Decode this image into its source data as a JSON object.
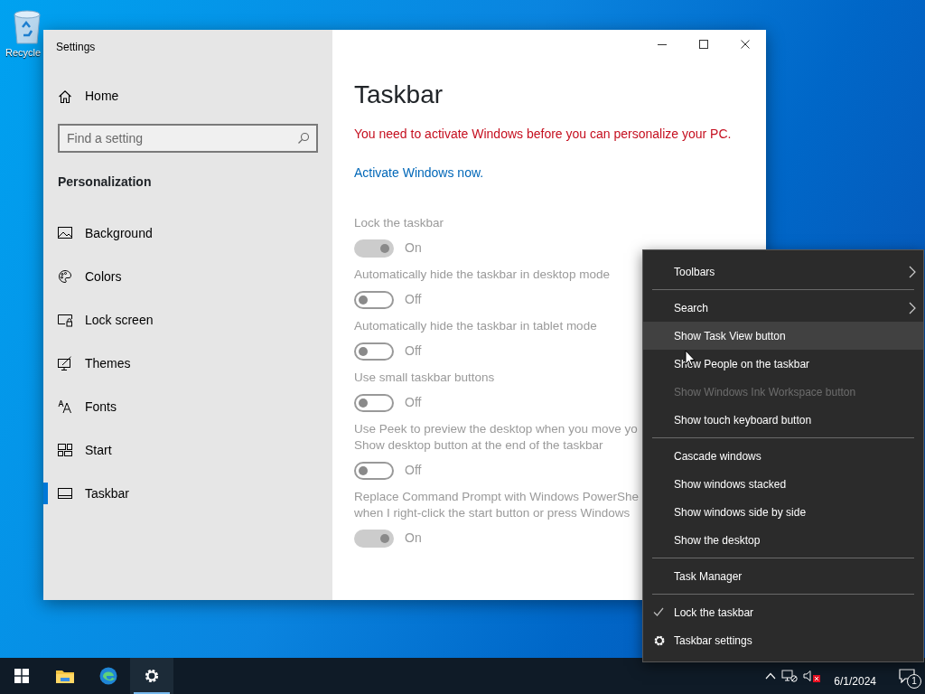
{
  "desktop": {
    "icons": [
      {
        "label": "Recycle"
      }
    ]
  },
  "settings_window": {
    "title": "Settings",
    "sidebar": {
      "home": "Home",
      "search": {
        "placeholder": "Find a setting"
      },
      "section": "Personalization",
      "items": [
        {
          "label": "Background",
          "selected": false
        },
        {
          "label": "Colors",
          "selected": false
        },
        {
          "label": "Lock screen",
          "selected": false
        },
        {
          "label": "Themes",
          "selected": false
        },
        {
          "label": "Fonts",
          "selected": false
        },
        {
          "label": "Start",
          "selected": false
        },
        {
          "label": "Taskbar",
          "selected": true
        }
      ]
    },
    "content": {
      "title": "Taskbar",
      "warning": "You need to activate Windows before you can personalize your PC.",
      "link": "Activate Windows now.",
      "disabled": true,
      "toggles": [
        {
          "label": "Lock the taskbar",
          "on": true,
          "state_text": "On"
        },
        {
          "label": "Automatically hide the taskbar in desktop mode",
          "on": false,
          "state_text": "Off"
        },
        {
          "label": "Automatically hide the taskbar in tablet mode",
          "on": false,
          "state_text": "Off"
        },
        {
          "label": "Use small taskbar buttons",
          "on": false,
          "state_text": "Off"
        },
        {
          "label": "Use Peek to preview the desktop when you move yo\nShow desktop button at the end of the taskbar",
          "on": false,
          "state_text": "Off"
        },
        {
          "label": "Replace Command Prompt with Windows PowerShe\nwhen I right-click the start button or press Windows",
          "on": true,
          "state_text": "On"
        }
      ]
    }
  },
  "context_menu": {
    "items": [
      {
        "kind": "submenu",
        "label": "Toolbars",
        "selected": false,
        "disabled": false
      },
      {
        "kind": "separator"
      },
      {
        "kind": "submenu",
        "label": "Search",
        "selected": false,
        "disabled": false
      },
      {
        "kind": "command",
        "label": "Show Task View button",
        "selected": true,
        "disabled": false
      },
      {
        "kind": "command",
        "label": "Show People on the taskbar",
        "selected": false,
        "disabled": false
      },
      {
        "kind": "command",
        "label": "Show Windows Ink Workspace button",
        "selected": false,
        "disabled": true
      },
      {
        "kind": "command",
        "label": "Show touch keyboard button",
        "selected": false,
        "disabled": false
      },
      {
        "kind": "separator"
      },
      {
        "kind": "command",
        "label": "Cascade windows",
        "selected": false,
        "disabled": false
      },
      {
        "kind": "command",
        "label": "Show windows stacked",
        "selected": false,
        "disabled": false
      },
      {
        "kind": "command",
        "label": "Show windows side by side",
        "selected": false,
        "disabled": false
      },
      {
        "kind": "command",
        "label": "Show the desktop",
        "selected": false,
        "disabled": false
      },
      {
        "kind": "separator"
      },
      {
        "kind": "command",
        "label": "Task Manager",
        "selected": false,
        "disabled": false
      },
      {
        "kind": "separator"
      },
      {
        "kind": "check",
        "label": "Lock the taskbar",
        "selected": false,
        "disabled": false,
        "checked": true
      },
      {
        "kind": "settings",
        "label": "Taskbar settings",
        "selected": false,
        "disabled": false
      }
    ]
  },
  "taskbar": {
    "buttons": [
      {
        "kind": "start",
        "selected": false
      },
      {
        "kind": "explorer",
        "selected": false
      },
      {
        "kind": "edge",
        "selected": false
      },
      {
        "kind": "settings",
        "selected": true
      }
    ],
    "clock": "6/1/2024",
    "notifications": "1"
  }
}
